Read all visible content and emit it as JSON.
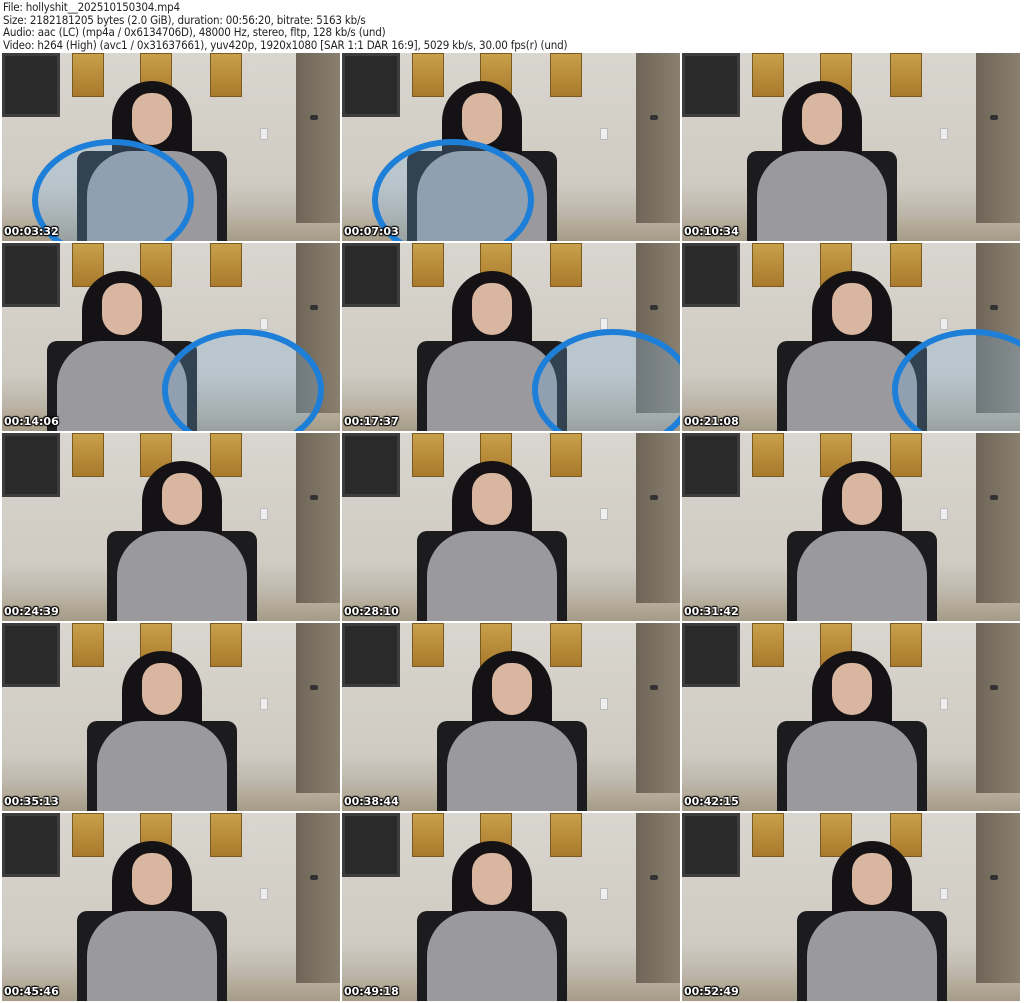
{
  "header": {
    "file": "File: hollyshit__202510150304.mp4",
    "size": "Size: 2182181205 bytes (2.0 GiB), duration: 00:56:20, bitrate: 5163 kb/s",
    "audio": "Audio: aac (LC) (mp4a / 0x6134706D), 48000 Hz, stereo, fltp, 128 kb/s (und)",
    "video": "Video: h264 (High) (avc1 / 0x31637661), yuv420p, 1920x1080 [SAR 1:1 DAR 16:9], 5029 kb/s, 30.00 fps(r) (und)"
  },
  "thumbnails": [
    {
      "timestamp": "00:03:32",
      "prop": true
    },
    {
      "timestamp": "00:07:03",
      "prop": true
    },
    {
      "timestamp": "00:10:34",
      "prop": false
    },
    {
      "timestamp": "00:14:06",
      "prop": true
    },
    {
      "timestamp": "00:17:37",
      "prop": true
    },
    {
      "timestamp": "00:21:08",
      "prop": true
    },
    {
      "timestamp": "00:24:39",
      "prop": false
    },
    {
      "timestamp": "00:28:10",
      "prop": false
    },
    {
      "timestamp": "00:31:42",
      "prop": false
    },
    {
      "timestamp": "00:35:13",
      "prop": false
    },
    {
      "timestamp": "00:38:44",
      "prop": false
    },
    {
      "timestamp": "00:42:15",
      "prop": false
    },
    {
      "timestamp": "00:45:46",
      "prop": false
    },
    {
      "timestamp": "00:49:18",
      "prop": false
    },
    {
      "timestamp": "00:52:49",
      "prop": false
    }
  ]
}
